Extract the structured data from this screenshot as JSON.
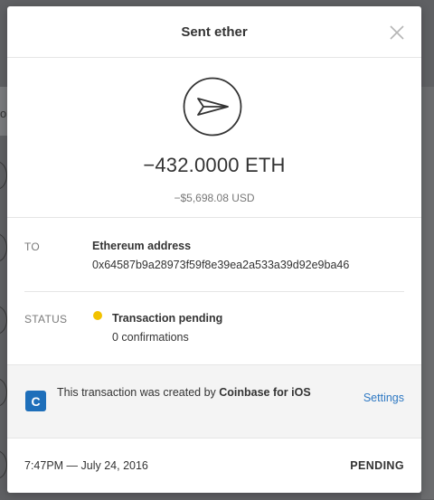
{
  "background": {
    "partial_letter": "o"
  },
  "modal": {
    "title": "Sent ether",
    "close_icon": "close-icon",
    "hero_icon": "paper-plane-send-icon",
    "amount": "−432.0000 ETH",
    "fiat_amount": "−$5,698.08 USD",
    "to": {
      "label": "TO",
      "title": "Ethereum address",
      "address": "0x64587b9a28973f59f8e39ea2a533a39d92e9ba46"
    },
    "status": {
      "label": "STATUS",
      "title": "Transaction pending",
      "detail": "0 confirmations",
      "dot_color": "#f2c200"
    },
    "origin": {
      "logo_letter": "C",
      "text_prefix": "This transaction was created by ",
      "text_app": "Coinbase for iOS",
      "settings_label": "Settings",
      "logo_color": "#1e6fba",
      "link_color": "#2f79c3"
    },
    "footer": {
      "timestamp": "7:47PM — July 24, 2016",
      "state": "PENDING"
    }
  }
}
